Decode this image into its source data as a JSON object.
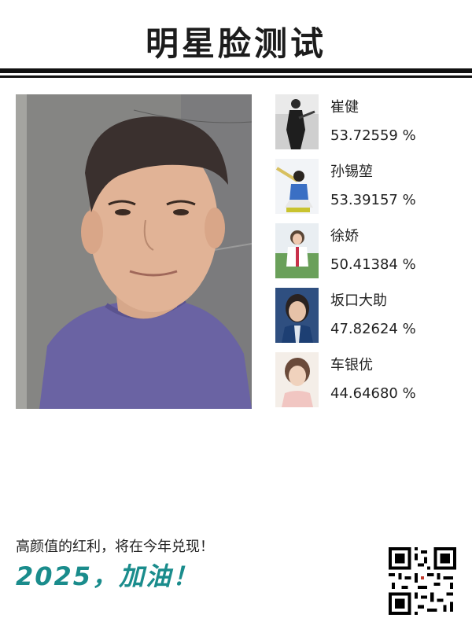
{
  "title": "明星脸测试",
  "matches": [
    {
      "name": "崔健",
      "score": "53.72559 %"
    },
    {
      "name": "孙锡堃",
      "score": "53.39157 %"
    },
    {
      "name": "徐娇",
      "score": "50.41384 %"
    },
    {
      "name": "坂口大助",
      "score": "47.82624 %"
    },
    {
      "name": "车银优",
      "score": "44.64680 %"
    }
  ],
  "footer": {
    "slogan": "高颜值的红利，将在今年兑现！",
    "cheer": "2025，加油！"
  },
  "colors": {
    "accent": "#1a8c8c",
    "rule": "#111111"
  }
}
